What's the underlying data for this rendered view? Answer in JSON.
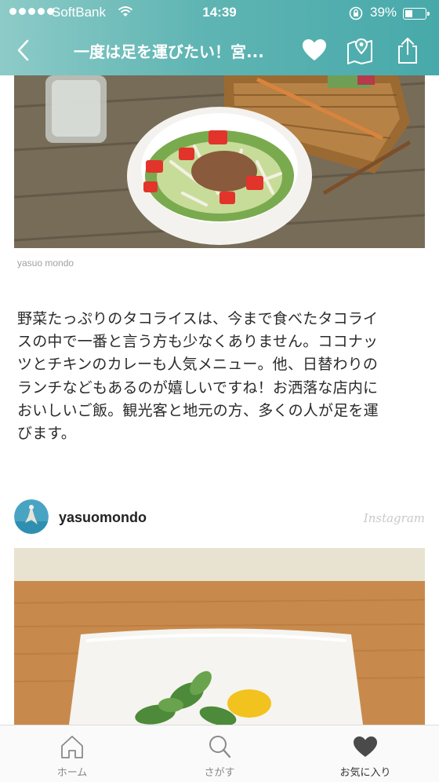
{
  "status_bar": {
    "carrier": "SoftBank",
    "time": "14:39",
    "battery": "39%"
  },
  "nav": {
    "title": "一度は足を運びたい！宮..."
  },
  "article": {
    "photo_credit": "yasuo mondo",
    "paragraph_lines": [
      "野菜たっぷりのタコライスは、今まで食べたタコライ",
      "スの中で一番と言う方も少なくありません。ココナッ",
      "ツとチキンのカレーも人気メニュー。他、日替わりの",
      "ランチなどもあるのが嬉しいですね！お洒落な店内に",
      "おいしいご飯。観光客と地元の方、多くの人が足を運",
      "びます。"
    ]
  },
  "instagram": {
    "username": "yasuomondo",
    "brand": "Instagram"
  },
  "tabbar": {
    "items": [
      {
        "label": "ホーム",
        "icon": "home-icon"
      },
      {
        "label": "さがす",
        "icon": "search-icon"
      },
      {
        "label": "お気に入り",
        "icon": "heart-icon"
      }
    ]
  },
  "colors": {
    "header_start": "#8dcbc8",
    "header_end": "#48a9aa",
    "tab_inactive": "#888888",
    "tab_active": "#333333"
  }
}
